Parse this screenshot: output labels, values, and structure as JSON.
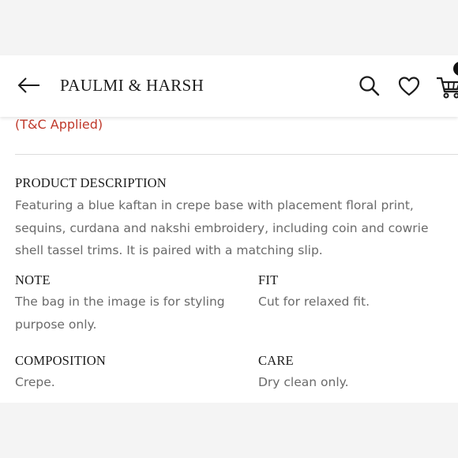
{
  "header": {
    "brand": "PAULMI & HARSH",
    "icons": [
      "back-arrow-icon",
      "search-icon",
      "heart-icon",
      "cart-icon"
    ]
  },
  "offer": {
    "terms": "(T&C Applied)",
    "color": "#c0392b"
  },
  "description": {
    "title": "PRODUCT DESCRIPTION",
    "text": "Featuring a blue kaftan in crepe base with placement floral print, sequins, curdana and nakshi embroidery, including coin and cowrie shell tassel trims. It is paired with a matching slip."
  },
  "note": {
    "title": "NOTE",
    "text": "The bag in the image is for styling purpose only."
  },
  "fit": {
    "title": "FIT",
    "text": "Cut for relaxed fit."
  },
  "composition": {
    "title": "COMPOSITION",
    "text": "Crepe."
  },
  "care": {
    "title": "CARE",
    "text": "Dry clean only."
  }
}
